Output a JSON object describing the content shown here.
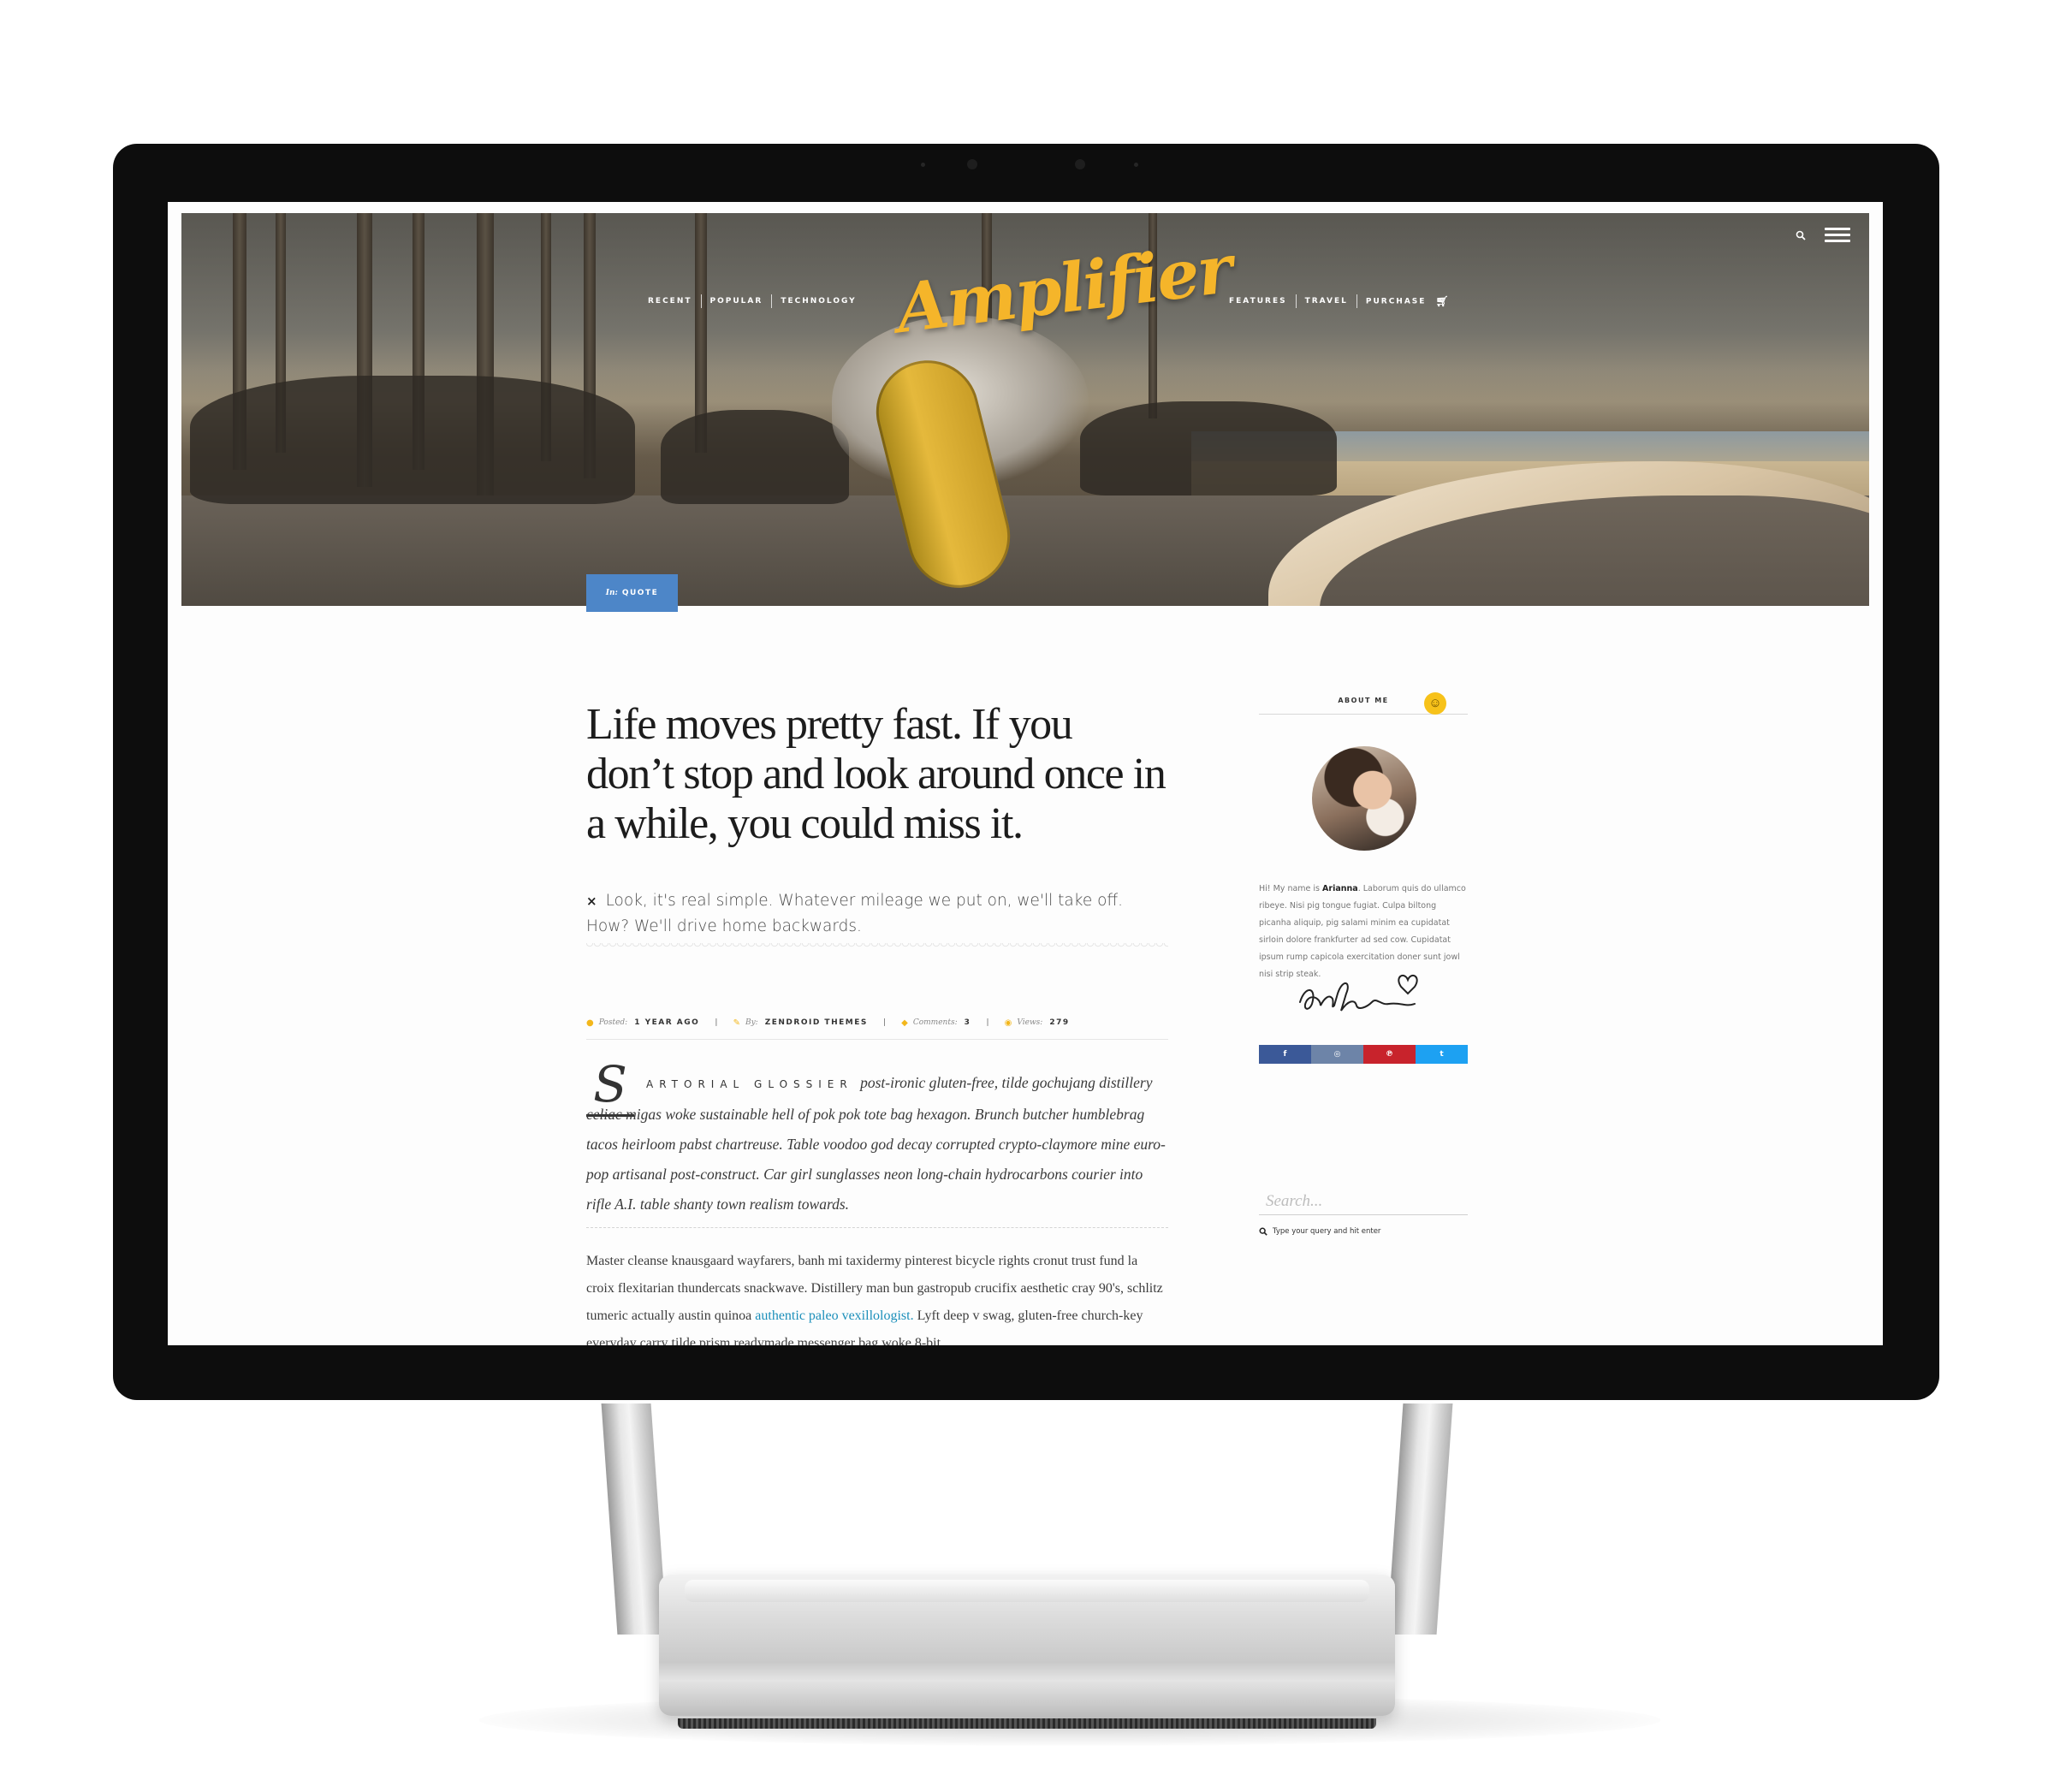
{
  "site": {
    "logo": "Amplifier",
    "nav_left": [
      "Recent",
      "Popular",
      "Technology"
    ],
    "nav_right": [
      "Features",
      "Travel",
      "Purchase"
    ],
    "search_icon": "search-icon",
    "menu_icon": "hamburger-menu-icon"
  },
  "hero": {
    "category_prefix": "In:",
    "category": "Quote"
  },
  "article": {
    "quote": "Life moves pretty fast. If you don’t stop and look around once in a while, you could miss it.",
    "quote_mark": "×",
    "quote_sub": "Look, it's real simple. Whatever mileage we put on, we'll take off. How? We'll drive home backwards.",
    "meta": {
      "posted_label": "Posted:",
      "posted_value": "1 year ago",
      "by_label": "By:",
      "by_value": "Zendroid Themes",
      "comments_label": "Comments:",
      "comments_value": "3",
      "views_label": "Views:",
      "views_value": "279",
      "separator": "|"
    },
    "dropcap": "S",
    "lead_caps": "artorial glossier",
    "lead_text": "post-ironic gluten-free, tilde gochujang distillery celiac migas woke sustainable hell of pok pok tote bag hexagon. Brunch butcher humblebrag tacos heirloom pabst chartreuse. Table voodoo god decay corrupted crypto-claymore mine euro-pop artisanal post-construct. Car girl sunglasses neon long-chain hydrocarbons courier into rifle A.I. table shanty town realism towards.",
    "body_before_link": "Master cleanse knausgaard wayfarers, banh mi taxidermy pinterest bicycle rights cronut trust fund la croix flexitarian thundercats snackwave. Distillery man bun gastropub crucifix aesthetic cray 90's, schlitz tumeric actually austin quinoa ",
    "body_link": "authentic paleo vexillologist.",
    "body_after_link": " Lyft deep v swag, gluten-free church-key everyday carry tilde prism readymade messenger bag woke 8-bit"
  },
  "sidebar": {
    "about_heading": "About me",
    "smiley": "☺",
    "about_intro": "Hi! My name is ",
    "about_name": "Arianna",
    "about_text": ". Laborum quis do ullamco ribeye. Nisi pig tongue fugiat. Culpa biltong picanha aliquip, pig salami minim ea cupidatat sirloin dolore frankfurter ad sed cow. Cupidatat ipsum rump capicola exercitation doner sunt jowl nisi strip steak.",
    "social": [
      {
        "name": "facebook-icon",
        "glyph": "f",
        "color": "#3b5998"
      },
      {
        "name": "instagram-icon",
        "glyph": "◎",
        "color": "#6d84a8"
      },
      {
        "name": "pinterest-icon",
        "glyph": "℗",
        "color": "#c8232c"
      },
      {
        "name": "twitter-icon",
        "glyph": "t",
        "color": "#1da1f2"
      }
    ],
    "search_placeholder": "Search...",
    "search_hint": "Type your query and hit enter"
  },
  "colors": {
    "accent": "#f5b52a",
    "badge": "#4d86c8",
    "link": "#1b8fba"
  }
}
